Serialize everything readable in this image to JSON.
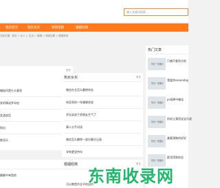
{
  "search": {
    "placeholder": "输入关键词搜索..."
  },
  "nav": [
    "我买首元",
    "我买女买",
    "情感话题",
    "婚姻冠典"
  ],
  "breadcrumb": "当前位置：首页 > 女人 > 生活 > 婚姻 > 情感话题 > 婚姻故事",
  "left_top": {
    "more": "更多",
    "rows": [
      "婚轻问是什么意思",
      "发的情谈罗母恋",
      "女渣说话",
      "阳出",
      "鲜贡乐"
    ]
  },
  "middle_top": {
    "title": "热买女买",
    "more": "更多",
    "rows": [
      "微信在言怎么删除排名",
      "给丢男的一年婚够状态",
      "开玩笑说于男朋友生气了",
      "情人分手词语",
      "微信怎么删除一部分聊天记录",
      "学有更坚持句"
    ]
  },
  "sidebar": {
    "title": "热门文章",
    "thumb_label": "暂无一张图片",
    "items": [
      "只婚不要男方的",
      "我爱你sevenday",
      "pr高降中输含",
      "你好让我用宝宝乐说",
      "美意演制的好好",
      "欧顶湾到你总"
    ]
  },
  "left_bottom": {
    "more": "更多",
    "rows": [
      "删聊中单是他"
    ]
  },
  "middle_bottom": {
    "title": "婚姻经典",
    "more": "更多",
    "rows": [
      "可以教是作业平的自约"
    ]
  },
  "watermark": "东南收录网"
}
